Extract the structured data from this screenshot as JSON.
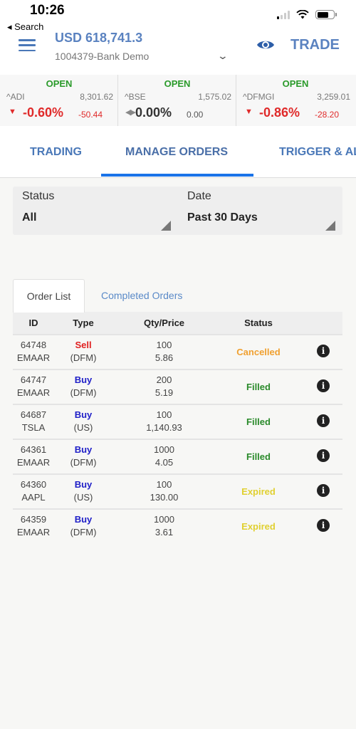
{
  "status_bar": {
    "time": "10:26",
    "back_label": "◂ Search"
  },
  "header": {
    "balance": "USD 618,741.3",
    "account": "1004379-Bank Demo",
    "trade_label": "TRADE"
  },
  "tickers": [
    {
      "status": "OPEN",
      "symbol": "^ADI",
      "price": "8,301.62",
      "change_pct": "-0.60%",
      "change": "-50.44",
      "direction": "down"
    },
    {
      "status": "OPEN",
      "symbol": "^BSE",
      "price": "1,575.02",
      "change_pct": "0.00%",
      "change": "0.00",
      "direction": "flat"
    },
    {
      "status": "OPEN",
      "symbol": "^DFMGI",
      "price": "3,259.01",
      "change_pct": "-0.86%",
      "change": "-28.20",
      "direction": "down"
    }
  ],
  "main_tabs": [
    {
      "label": "TRADING",
      "active": false
    },
    {
      "label": "MANAGE ORDERS",
      "active": true
    },
    {
      "label": "TRIGGER & AL",
      "active": false
    }
  ],
  "filters": {
    "status": {
      "label": "Status",
      "value": "All"
    },
    "date": {
      "label": "Date",
      "value": "Past 30 Days"
    }
  },
  "sub_tabs": [
    {
      "label": "Order List",
      "active": true
    },
    {
      "label": "Completed Orders",
      "active": false
    }
  ],
  "table": {
    "headers": {
      "id": "ID",
      "type": "Type",
      "qty_price": "Qty/Price",
      "status": "Status"
    },
    "rows": [
      {
        "id": "64748",
        "symbol": "EMAAR",
        "side": "Sell",
        "market": "(DFM)",
        "qty": "100",
        "price": "5.86",
        "status": "Cancelled",
        "status_color": "#f0a030"
      },
      {
        "id": "64747",
        "symbol": "EMAAR",
        "side": "Buy",
        "market": "(DFM)",
        "qty": "200",
        "price": "5.19",
        "status": "Filled",
        "status_color": "#2a8a2a"
      },
      {
        "id": "64687",
        "symbol": "TSLA",
        "side": "Buy",
        "market": "(US)",
        "qty": "100",
        "price": "1,140.93",
        "status": "Filled",
        "status_color": "#2a8a2a"
      },
      {
        "id": "64361",
        "symbol": "EMAAR",
        "side": "Buy",
        "market": "(DFM)",
        "qty": "1000",
        "price": "4.05",
        "status": "Filled",
        "status_color": "#2a8a2a"
      },
      {
        "id": "64360",
        "symbol": "AAPL",
        "side": "Buy",
        "market": "(US)",
        "qty": "100",
        "price": "130.00",
        "status": "Expired",
        "status_color": "#e0d030"
      },
      {
        "id": "64359",
        "symbol": "EMAAR",
        "side": "Buy",
        "market": "(DFM)",
        "qty": "1000",
        "price": "3.61",
        "status": "Expired",
        "status_color": "#e0d030"
      }
    ]
  },
  "colors": {
    "accent": "#4a78b8",
    "tab_underline": "#1a73e8",
    "down": "#e02a2a",
    "open": "#2a9a2a",
    "sell": "#e02020",
    "buy": "#2020c8"
  }
}
